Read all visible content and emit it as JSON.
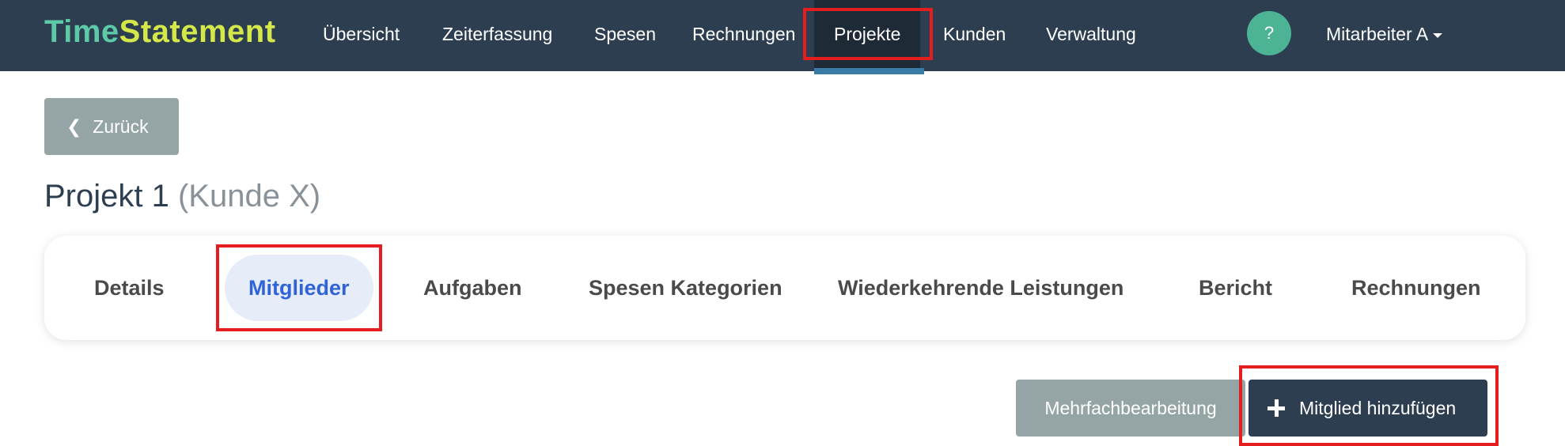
{
  "brand": {
    "part1": "Time",
    "part2": "Statement"
  },
  "nav": {
    "items": [
      {
        "label": "Übersicht"
      },
      {
        "label": "Zeiterfassung"
      },
      {
        "label": "Spesen"
      },
      {
        "label": "Rechnungen"
      },
      {
        "label": "Projekte",
        "active": true
      },
      {
        "label": "Kunden"
      },
      {
        "label": "Verwaltung"
      }
    ],
    "help_label": "?",
    "user_label": "Mitarbeiter A"
  },
  "back_button": {
    "label": "Zurück"
  },
  "page": {
    "title": "Projekt 1",
    "subtitle": "(Kunde X)"
  },
  "tabs": [
    {
      "label": "Details"
    },
    {
      "label": "Mitglieder",
      "active": true
    },
    {
      "label": "Aufgaben"
    },
    {
      "label": "Spesen Kategorien"
    },
    {
      "label": "Wiederkehrende Leistungen"
    },
    {
      "label": "Bericht"
    },
    {
      "label": "Rechnungen"
    }
  ],
  "actions": {
    "bulk_edit_label": "Mehrfachbearbeitung",
    "add_member_label": "Mitglied hinzufügen"
  },
  "colors": {
    "navbar": "#2c3e50",
    "brand_time": "#5cc9a7",
    "brand_statement": "#d4e84a",
    "active_tab_text": "#2f63d6",
    "highlight": "#e41e1e"
  }
}
